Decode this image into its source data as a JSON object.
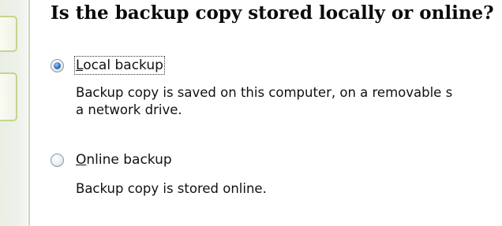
{
  "heading": "Is the backup copy stored locally or online?",
  "options": [
    {
      "label_mnemonic": "L",
      "label_rest": "ocal backup",
      "selected": true,
      "description_lines": [
        "Backup copy is saved on this computer, on a removable s",
        "a network drive."
      ]
    },
    {
      "label_mnemonic": "O",
      "label_rest": "nline backup",
      "selected": false,
      "description_lines": [
        "Backup copy is stored online."
      ]
    }
  ],
  "colors": {
    "radio_selected": "#2f6fc1",
    "tab_border": "#c7d48e",
    "left_border": "#c9d6c2"
  }
}
